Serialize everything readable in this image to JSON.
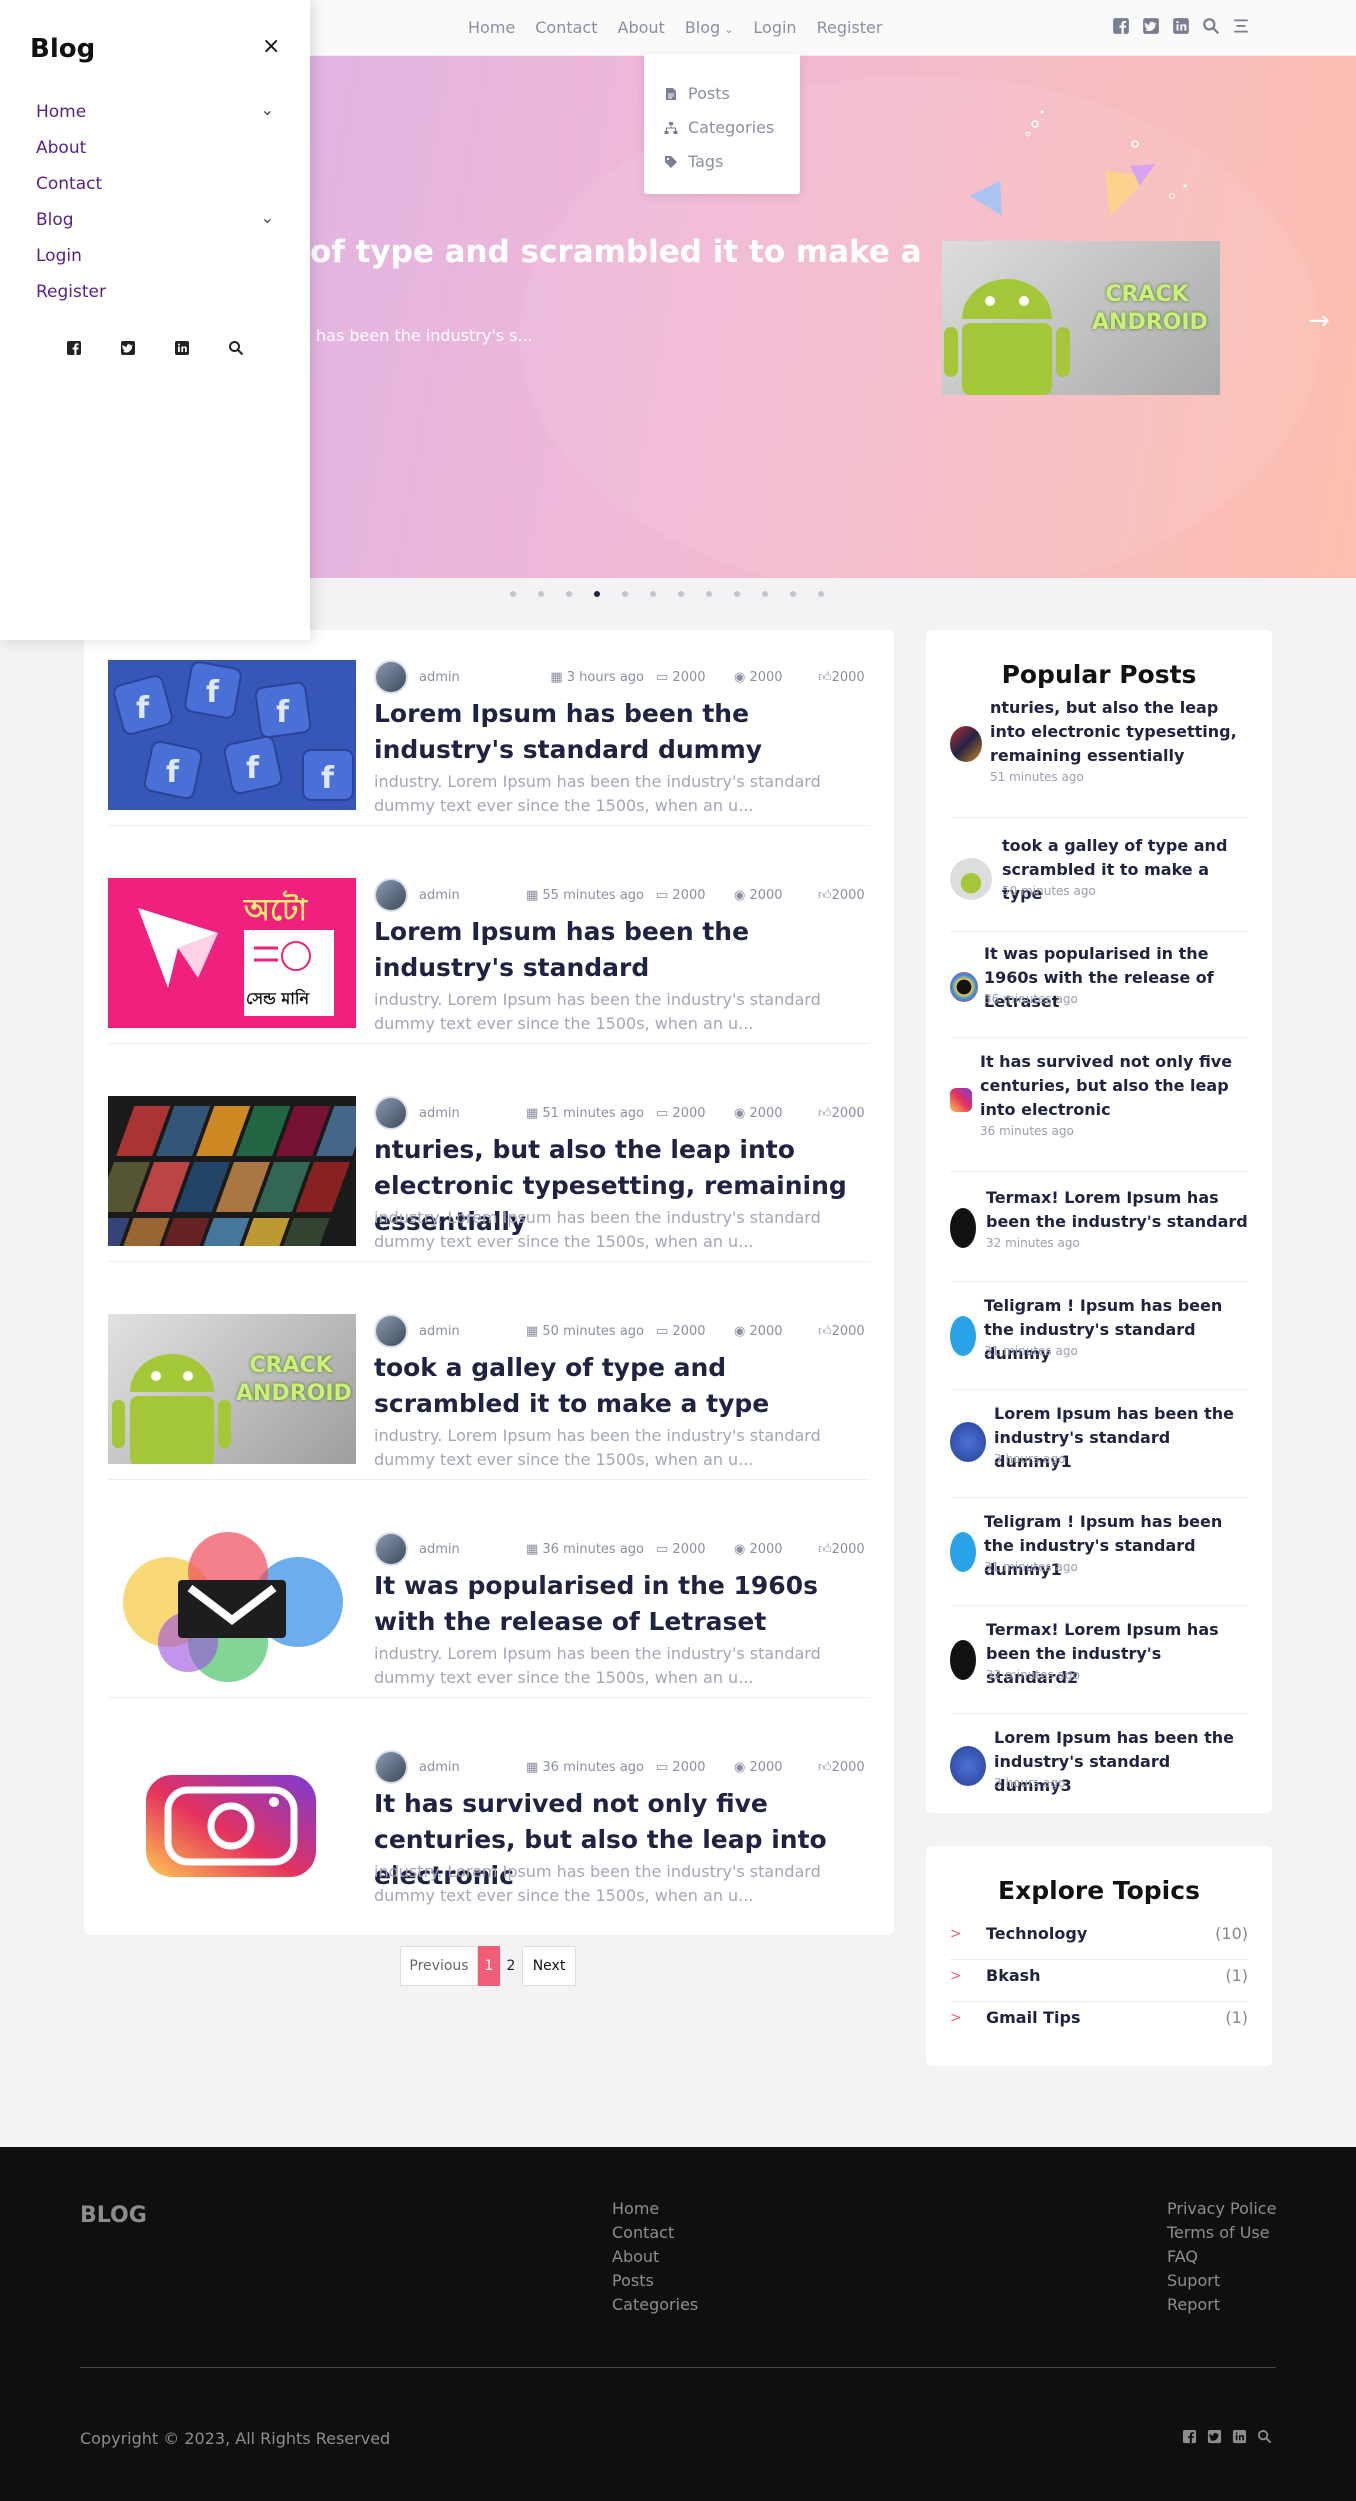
{
  "nav": {
    "links": [
      "Home",
      "Contact",
      "About",
      "Blog",
      "Login",
      "Register"
    ],
    "dropdown": [
      "Posts",
      "Categories",
      "Tags"
    ]
  },
  "sidebar": {
    "brand": "Blog",
    "close": "×",
    "items": [
      "Home",
      "About",
      "Contact",
      "Blog",
      "Login",
      "Register"
    ]
  },
  "hero": {
    "title": "ey of type and scrambled it to make a",
    "excerpt": "has been the industry's s...",
    "image_text": "CRACK ANDROID"
  },
  "posts": [
    {
      "author": "admin",
      "time": "3 hours ago",
      "comments": "2000",
      "views": "2000",
      "likes": "2000",
      "title": "Lorem Ipsum has been the industry's standard dummy",
      "excerpt": "industry. Lorem Ipsum has been the industry's standard dummy text ever since the 1500s, when an u..."
    },
    {
      "author": "admin",
      "time": "55 minutes ago",
      "comments": "2000",
      "views": "2000",
      "likes": "2000",
      "title": "Lorem Ipsum has been the industry's standard",
      "excerpt": "industry. Lorem Ipsum has been the industry's standard dummy text ever since the 1500s, when an u..."
    },
    {
      "author": "admin",
      "time": "51 minutes ago",
      "comments": "2000",
      "views": "2000",
      "likes": "2000",
      "title": "nturies, but also the leap into electronic typesetting, remaining essentially",
      "excerpt": "industry. Lorem Ipsum has been the industry's standard dummy text ever since the 1500s, when an u..."
    },
    {
      "author": "admin",
      "time": "50 minutes ago",
      "comments": "2000",
      "views": "2000",
      "likes": "2000",
      "title": "took a galley of type and scrambled it to make a type",
      "excerpt": "industry. Lorem Ipsum has been the industry's standard dummy text ever since the 1500s, when an u..."
    },
    {
      "author": "admin",
      "time": "36 minutes ago",
      "comments": "2000",
      "views": "2000",
      "likes": "2000",
      "title": "It was popularised in the 1960s with the release of Letraset",
      "excerpt": "industry. Lorem Ipsum has been the industry's standard dummy text ever since the 1500s, when an u..."
    },
    {
      "author": "admin",
      "time": "36 minutes ago",
      "comments": "2000",
      "views": "2000",
      "likes": "2000",
      "title": "It has survived not only five centuries, but also the leap into electronic",
      "excerpt": "industry. Lorem Ipsum has been the industry's standard dummy text ever since the 1500s, when an u..."
    }
  ],
  "thumb_text": {
    "bn_title": "অটো",
    "bn_sub": "সেন্ড মানি",
    "crack": "CRACK ANDROID"
  },
  "pager": {
    "prev": "Previous",
    "p1": "1",
    "p2": "2",
    "next": "Next"
  },
  "popular": {
    "heading": "Popular Posts",
    "items": [
      {
        "title": "nturies, but also the leap into electronic typesetting, remaining essentially",
        "date": "51 minutes ago"
      },
      {
        "title": "took a galley of type and scrambled it to make a type",
        "date": "50 minutes ago"
      },
      {
        "title": "It was popularised in the 1960s with the release of Letraset",
        "date": "36 minutes ago"
      },
      {
        "title": "It has survived not only five centuries, but also the leap into electronic",
        "date": "36 minutes ago"
      },
      {
        "title": "Termax! Lorem Ipsum has been the industry's standard",
        "date": "32 minutes ago"
      },
      {
        "title": "Teligram ! Ipsum has been the industry's standard dummy",
        "date": "31 minutes ago"
      },
      {
        "title": "Lorem Ipsum has been the industry's standard dummy1",
        "date": "3 hours ago"
      },
      {
        "title": "Teligram ! Ipsum has been the industry's standard dummy1",
        "date": "31 minutes ago"
      },
      {
        "title": "Termax! Lorem Ipsum has been the industry's standard2",
        "date": "32 minutes ago"
      },
      {
        "title": "Lorem Ipsum has been the industry's standard dummy3",
        "date": "3 hours ago"
      }
    ]
  },
  "topics": {
    "heading": "Explore Topics",
    "items": [
      {
        "name": "Technology",
        "count": "(10)"
      },
      {
        "name": "Bkash",
        "count": "(1)"
      },
      {
        "name": "Gmail Tips",
        "count": "(1)"
      }
    ]
  },
  "footer": {
    "brand": "BLOG",
    "col1": [
      "Home",
      "Contact",
      "About",
      "Posts",
      "Categories"
    ],
    "col2": [
      "Privacy Police",
      "Terms of Use",
      "FAQ",
      "Suport",
      "Report"
    ],
    "copyright": "Copyright © 2023, All Rights Reserved"
  },
  "icons": [
    "facebook-icon",
    "twitter-icon",
    "linkedin-icon",
    "search-icon",
    "menu-icon",
    "close-icon",
    "chevron-down-icon",
    "arrow-right-icon",
    "file-icon",
    "sitemap-icon",
    "tags-icon",
    "calendar-icon",
    "comment-icon",
    "eye-icon",
    "thumbs-up-icon"
  ],
  "colors": {
    "accent": "#f25d79",
    "title": "#1e2343",
    "sidebar_link": "#5a1f8c",
    "footer_bg": "#0f0f0f"
  }
}
